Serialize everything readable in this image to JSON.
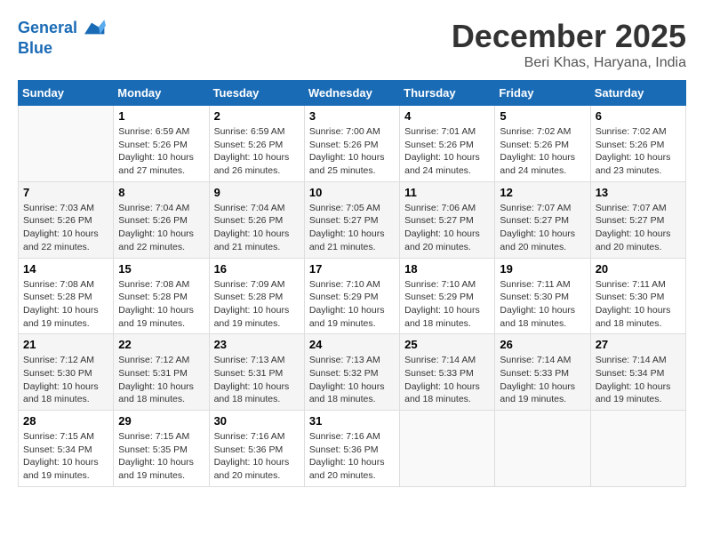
{
  "logo": {
    "line1": "General",
    "line2": "Blue"
  },
  "title": "December 2025",
  "location": "Beri Khas, Haryana, India",
  "weekdays": [
    "Sunday",
    "Monday",
    "Tuesday",
    "Wednesday",
    "Thursday",
    "Friday",
    "Saturday"
  ],
  "weeks": [
    [
      {
        "day": "",
        "info": ""
      },
      {
        "day": "1",
        "info": "Sunrise: 6:59 AM\nSunset: 5:26 PM\nDaylight: 10 hours\nand 27 minutes."
      },
      {
        "day": "2",
        "info": "Sunrise: 6:59 AM\nSunset: 5:26 PM\nDaylight: 10 hours\nand 26 minutes."
      },
      {
        "day": "3",
        "info": "Sunrise: 7:00 AM\nSunset: 5:26 PM\nDaylight: 10 hours\nand 25 minutes."
      },
      {
        "day": "4",
        "info": "Sunrise: 7:01 AM\nSunset: 5:26 PM\nDaylight: 10 hours\nand 24 minutes."
      },
      {
        "day": "5",
        "info": "Sunrise: 7:02 AM\nSunset: 5:26 PM\nDaylight: 10 hours\nand 24 minutes."
      },
      {
        "day": "6",
        "info": "Sunrise: 7:02 AM\nSunset: 5:26 PM\nDaylight: 10 hours\nand 23 minutes."
      }
    ],
    [
      {
        "day": "7",
        "info": "Sunrise: 7:03 AM\nSunset: 5:26 PM\nDaylight: 10 hours\nand 22 minutes."
      },
      {
        "day": "8",
        "info": "Sunrise: 7:04 AM\nSunset: 5:26 PM\nDaylight: 10 hours\nand 22 minutes."
      },
      {
        "day": "9",
        "info": "Sunrise: 7:04 AM\nSunset: 5:26 PM\nDaylight: 10 hours\nand 21 minutes."
      },
      {
        "day": "10",
        "info": "Sunrise: 7:05 AM\nSunset: 5:27 PM\nDaylight: 10 hours\nand 21 minutes."
      },
      {
        "day": "11",
        "info": "Sunrise: 7:06 AM\nSunset: 5:27 PM\nDaylight: 10 hours\nand 20 minutes."
      },
      {
        "day": "12",
        "info": "Sunrise: 7:07 AM\nSunset: 5:27 PM\nDaylight: 10 hours\nand 20 minutes."
      },
      {
        "day": "13",
        "info": "Sunrise: 7:07 AM\nSunset: 5:27 PM\nDaylight: 10 hours\nand 20 minutes."
      }
    ],
    [
      {
        "day": "14",
        "info": "Sunrise: 7:08 AM\nSunset: 5:28 PM\nDaylight: 10 hours\nand 19 minutes."
      },
      {
        "day": "15",
        "info": "Sunrise: 7:08 AM\nSunset: 5:28 PM\nDaylight: 10 hours\nand 19 minutes."
      },
      {
        "day": "16",
        "info": "Sunrise: 7:09 AM\nSunset: 5:28 PM\nDaylight: 10 hours\nand 19 minutes."
      },
      {
        "day": "17",
        "info": "Sunrise: 7:10 AM\nSunset: 5:29 PM\nDaylight: 10 hours\nand 19 minutes."
      },
      {
        "day": "18",
        "info": "Sunrise: 7:10 AM\nSunset: 5:29 PM\nDaylight: 10 hours\nand 18 minutes."
      },
      {
        "day": "19",
        "info": "Sunrise: 7:11 AM\nSunset: 5:30 PM\nDaylight: 10 hours\nand 18 minutes."
      },
      {
        "day": "20",
        "info": "Sunrise: 7:11 AM\nSunset: 5:30 PM\nDaylight: 10 hours\nand 18 minutes."
      }
    ],
    [
      {
        "day": "21",
        "info": "Sunrise: 7:12 AM\nSunset: 5:30 PM\nDaylight: 10 hours\nand 18 minutes."
      },
      {
        "day": "22",
        "info": "Sunrise: 7:12 AM\nSunset: 5:31 PM\nDaylight: 10 hours\nand 18 minutes."
      },
      {
        "day": "23",
        "info": "Sunrise: 7:13 AM\nSunset: 5:31 PM\nDaylight: 10 hours\nand 18 minutes."
      },
      {
        "day": "24",
        "info": "Sunrise: 7:13 AM\nSunset: 5:32 PM\nDaylight: 10 hours\nand 18 minutes."
      },
      {
        "day": "25",
        "info": "Sunrise: 7:14 AM\nSunset: 5:33 PM\nDaylight: 10 hours\nand 18 minutes."
      },
      {
        "day": "26",
        "info": "Sunrise: 7:14 AM\nSunset: 5:33 PM\nDaylight: 10 hours\nand 19 minutes."
      },
      {
        "day": "27",
        "info": "Sunrise: 7:14 AM\nSunset: 5:34 PM\nDaylight: 10 hours\nand 19 minutes."
      }
    ],
    [
      {
        "day": "28",
        "info": "Sunrise: 7:15 AM\nSunset: 5:34 PM\nDaylight: 10 hours\nand 19 minutes."
      },
      {
        "day": "29",
        "info": "Sunrise: 7:15 AM\nSunset: 5:35 PM\nDaylight: 10 hours\nand 19 minutes."
      },
      {
        "day": "30",
        "info": "Sunrise: 7:16 AM\nSunset: 5:36 PM\nDaylight: 10 hours\nand 20 minutes."
      },
      {
        "day": "31",
        "info": "Sunrise: 7:16 AM\nSunset: 5:36 PM\nDaylight: 10 hours\nand 20 minutes."
      },
      {
        "day": "",
        "info": ""
      },
      {
        "day": "",
        "info": ""
      },
      {
        "day": "",
        "info": ""
      }
    ]
  ]
}
